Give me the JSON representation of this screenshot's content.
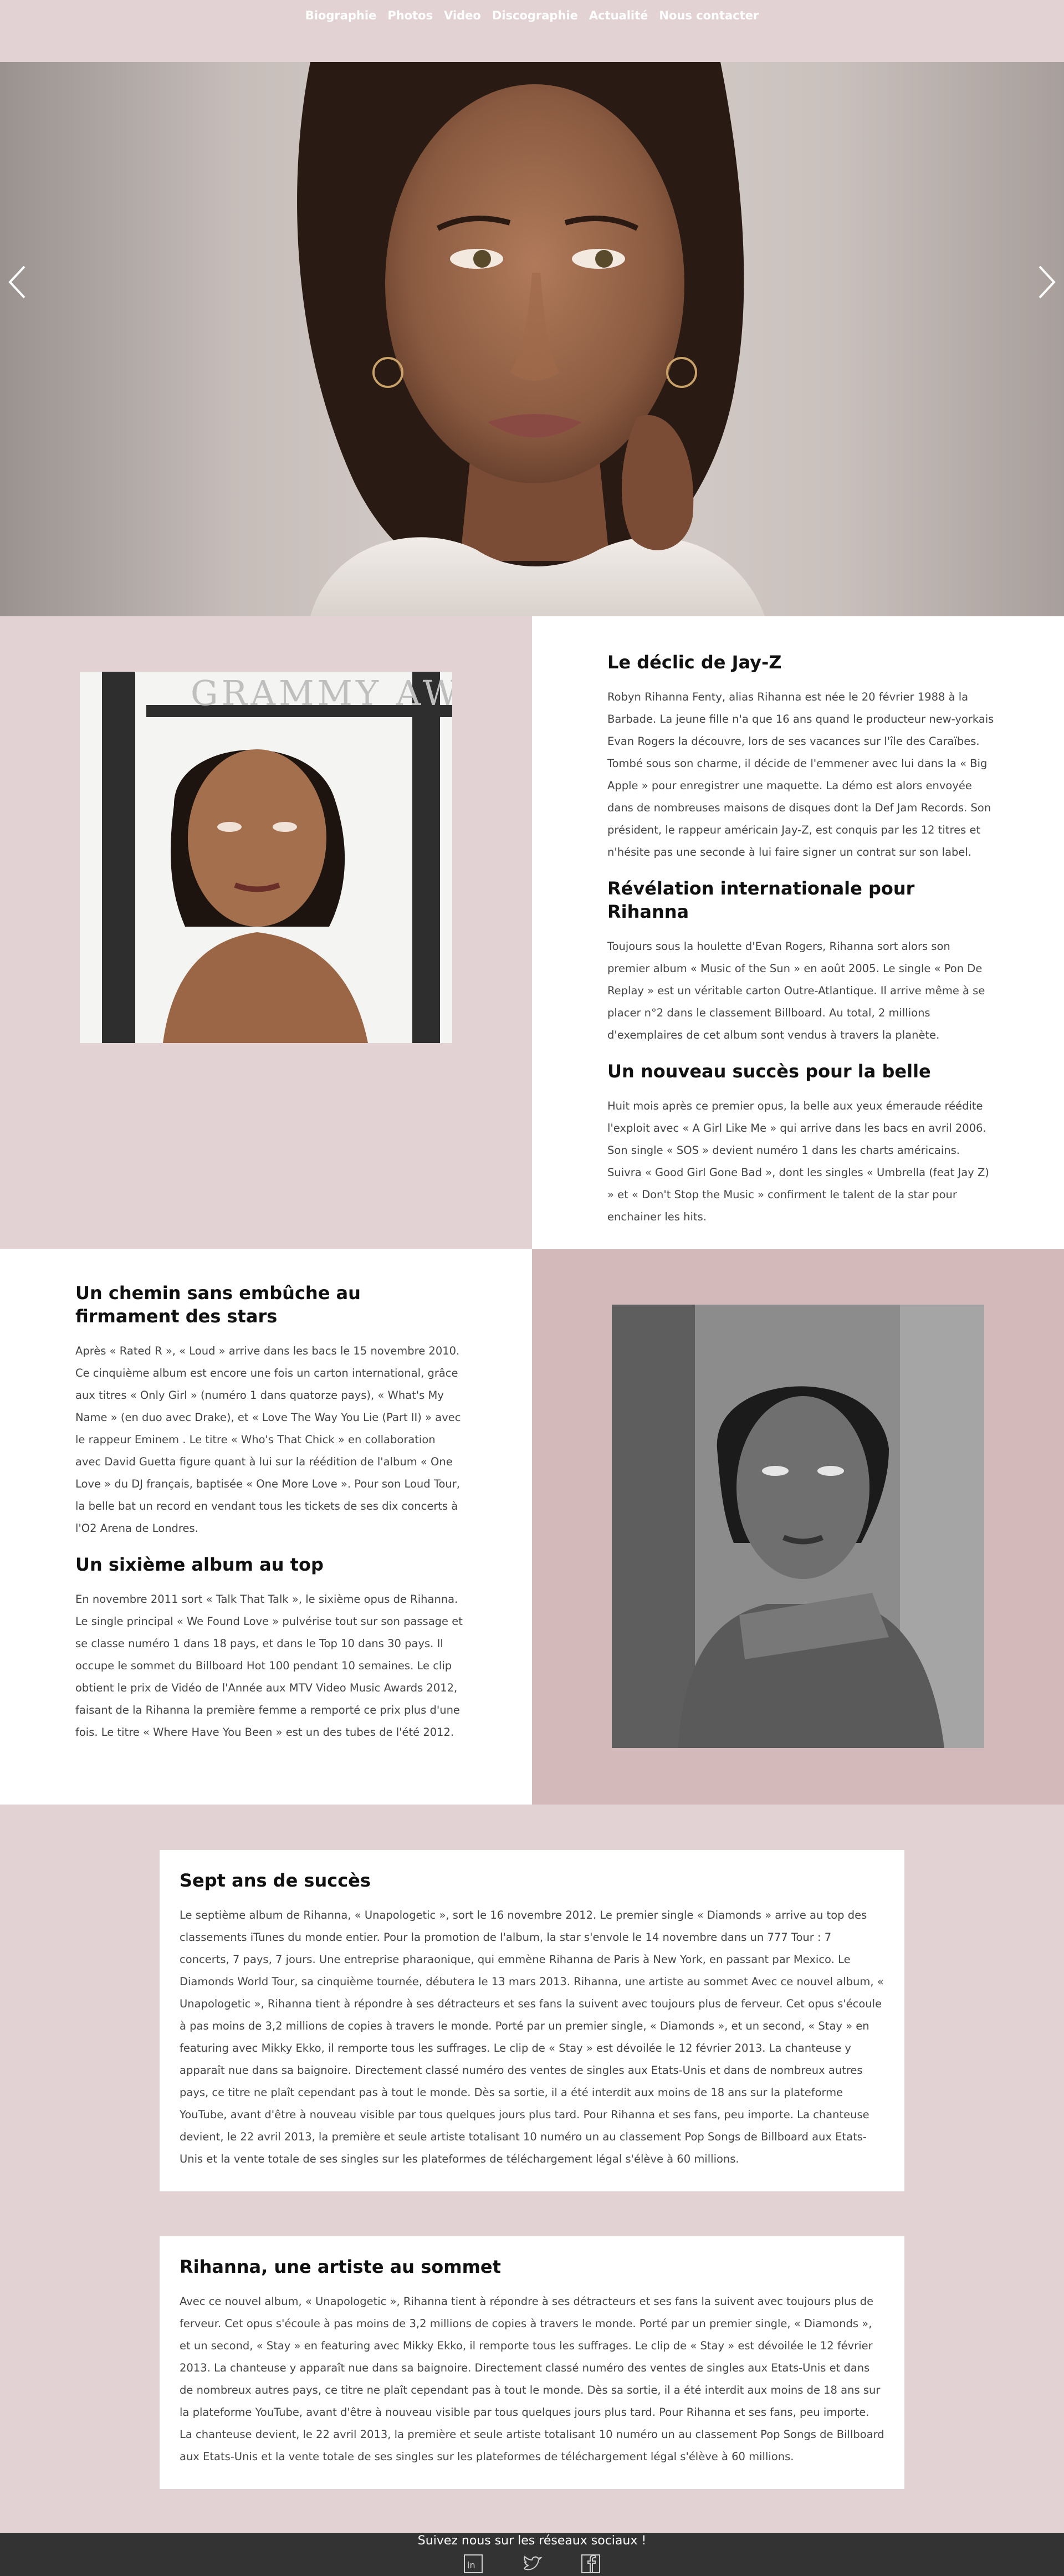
{
  "nav": {
    "items": [
      "Biographie",
      "Photos",
      "Video",
      "Discographie",
      "Actualité",
      "Nous contacter"
    ]
  },
  "section1": {
    "blocks": [
      {
        "title": "Le déclic de Jay-Z",
        "text": "Robyn Rihanna Fenty, alias Rihanna est née le 20 février 1988 à la Barbade. La jeune fille n'a que 16 ans quand le producteur new-yorkais Evan Rogers la découvre, lors de ses vacances sur l'île des Caraïbes. Tombé sous son charme, il décide de l'emmener avec lui dans la « Big Apple » pour enregistrer une maquette. La démo est alors envoyée dans de nombreuses maisons de disques dont la Def Jam Records. Son président, le rappeur américain Jay-Z, est conquis par les 12 titres et n'hésite pas une seconde à lui faire signer un contrat sur son label."
      },
      {
        "title": "Révélation internationale pour Rihanna",
        "text": "Toujours sous la houlette d'Evan Rogers, Rihanna sort alors son premier album « Music of the Sun » en août 2005. Le single « Pon De Replay » est un véritable carton Outre-Atlantique. Il arrive même à se placer n°2 dans le classement Billboard. Au total, 2 millions d'exemplaires de cet album sont vendus à travers la planète."
      },
      {
        "title": "Un nouveau succès pour la belle",
        "text": "Huit mois après ce premier opus, la belle aux yeux émeraude réédite l'exploit avec « A Girl Like Me » qui arrive dans les bacs en avril 2006. Son single « SOS » devient numéro 1 dans les charts américains. Suivra « Good Girl Gone Bad », dont les singles « Umbrella (feat Jay Z) » et « Don't Stop the Music » confirment le talent de la star pour enchainer les hits."
      }
    ],
    "photo_bg_text": "GRAMMY AW"
  },
  "section2": {
    "blocks": [
      {
        "title": "Un chemin sans embûche au firmament des stars",
        "text": "Après « Rated R », « Loud » arrive dans les bacs le 15 novembre 2010. Ce cinquième album est encore une fois un carton international, grâce aux titres « Only Girl » (numéro 1 dans quatorze pays), « What's My Name » (en duo avec Drake), et « Love The Way You Lie (Part II) » avec le rappeur Eminem . Le titre « Who's That Chick » en collaboration avec David Guetta figure quant à lui sur la réédition de l'album « One Love » du DJ français, baptisée « One More Love ». Pour son Loud Tour, la belle bat un record en vendant tous les tickets de ses dix concerts à l'O2 Arena de Londres."
      },
      {
        "title": "Un sixième album au top",
        "text": "En novembre 2011 sort « Talk That Talk », le sixième opus de Rihanna. Le single principal « We Found Love » pulvérise tout sur son passage et se classe numéro 1 dans 18 pays, et dans le Top 10 dans 30 pays. Il occupe le sommet du Billboard Hot 100 pendant 10 semaines. Le clip obtient le prix de Vidéo de l'Année aux MTV Video Music Awards 2012, faisant de la Rihanna la première femme a remporté ce prix plus d'une fois. Le titre « Where Have You Been » est un des tubes de l'été 2012."
      }
    ]
  },
  "cards": [
    {
      "title": "Sept ans de succès",
      "text": "Le septième album de Rihanna, « Unapologetic », sort le 16 novembre 2012. Le premier single « Diamonds » arrive au top des classements iTunes du monde entier. Pour la promotion de l'album, la star s'envole le 14 novembre dans un 777 Tour : 7 concerts, 7 pays, 7 jours. Une entreprise pharaonique, qui emmène Rihanna de Paris à New York, en passant par Mexico. Le Diamonds World Tour, sa cinquième tournée, débutera le 13 mars 2013. Rihanna, une artiste au sommet Avec ce nouvel album, « Unapologetic », Rihanna tient à répondre à ses détracteurs et ses fans la suivent avec toujours plus de ferveur. Cet opus s'écoule à pas moins de 3,2 millions de copies à travers le monde. Porté par un premier single, « Diamonds », et un second, « Stay » en featuring avec Mikky Ekko, il remporte tous les suffrages. Le clip de « Stay » est dévoilée le 12 février 2013. La chanteuse y apparaît nue dans sa baignoire. Directement classé numéro des ventes de singles aux Etats-Unis et dans de nombreux autres pays, ce titre ne plaît cependant pas à tout le monde. Dès sa sortie, il a été interdit aux moins de 18 ans sur la plateforme YouTube, avant d'être à nouveau visible par tous quelques jours plus tard. Pour Rihanna et ses fans, peu importe. La chanteuse devient, le 22 avril 2013, la première et seule artiste totalisant 10 numéro un au classement Pop Songs de Billboard aux Etats-Unis et la vente totale de ses singles sur les plateformes de téléchargement légal s'élève à 60 millions."
    },
    {
      "title": "Rihanna, une artiste au sommet",
      "text": "Avec ce nouvel album, « Unapologetic », Rihanna tient à répondre à ses détracteurs et ses fans la suivent avec toujours plus de ferveur. Cet opus s'écoule à pas moins de 3,2 millions de copies à travers le monde. Porté par un premier single, « Diamonds », et un second, « Stay » en featuring avec Mikky Ekko, il remporte tous les suffrages. Le clip de « Stay » est dévoilée le 12 février 2013. La chanteuse y apparaît nue dans sa baignoire. Directement classé numéro des ventes de singles aux Etats-Unis et dans de nombreux autres pays, ce titre ne plaît cependant pas à tout le monde. Dès sa sortie, il a été interdit aux moins de 18 ans sur la plateforme YouTube, avant d'être à nouveau visible par tous quelques jours plus tard. Pour Rihanna et ses fans, peu importe. La chanteuse devient, le 22 avril 2013, la première et seule artiste totalisant 10 numéro un au classement Pop Songs de Billboard aux Etats-Unis et la vente totale de ses singles sur les plateformes de téléchargement légal s'élève à 60 millions."
    }
  ],
  "footer": {
    "follow": "Suivez nous sur les réseaux sociaux !",
    "icons": [
      "linkedin-icon",
      "twitter-icon",
      "facebook-icon"
    ]
  },
  "colors": {
    "pink_bg": "#e3d2d3",
    "dusty_bg": "#d3b9ba",
    "footer_bg": "#333333",
    "nav_text": "#ffffff"
  }
}
